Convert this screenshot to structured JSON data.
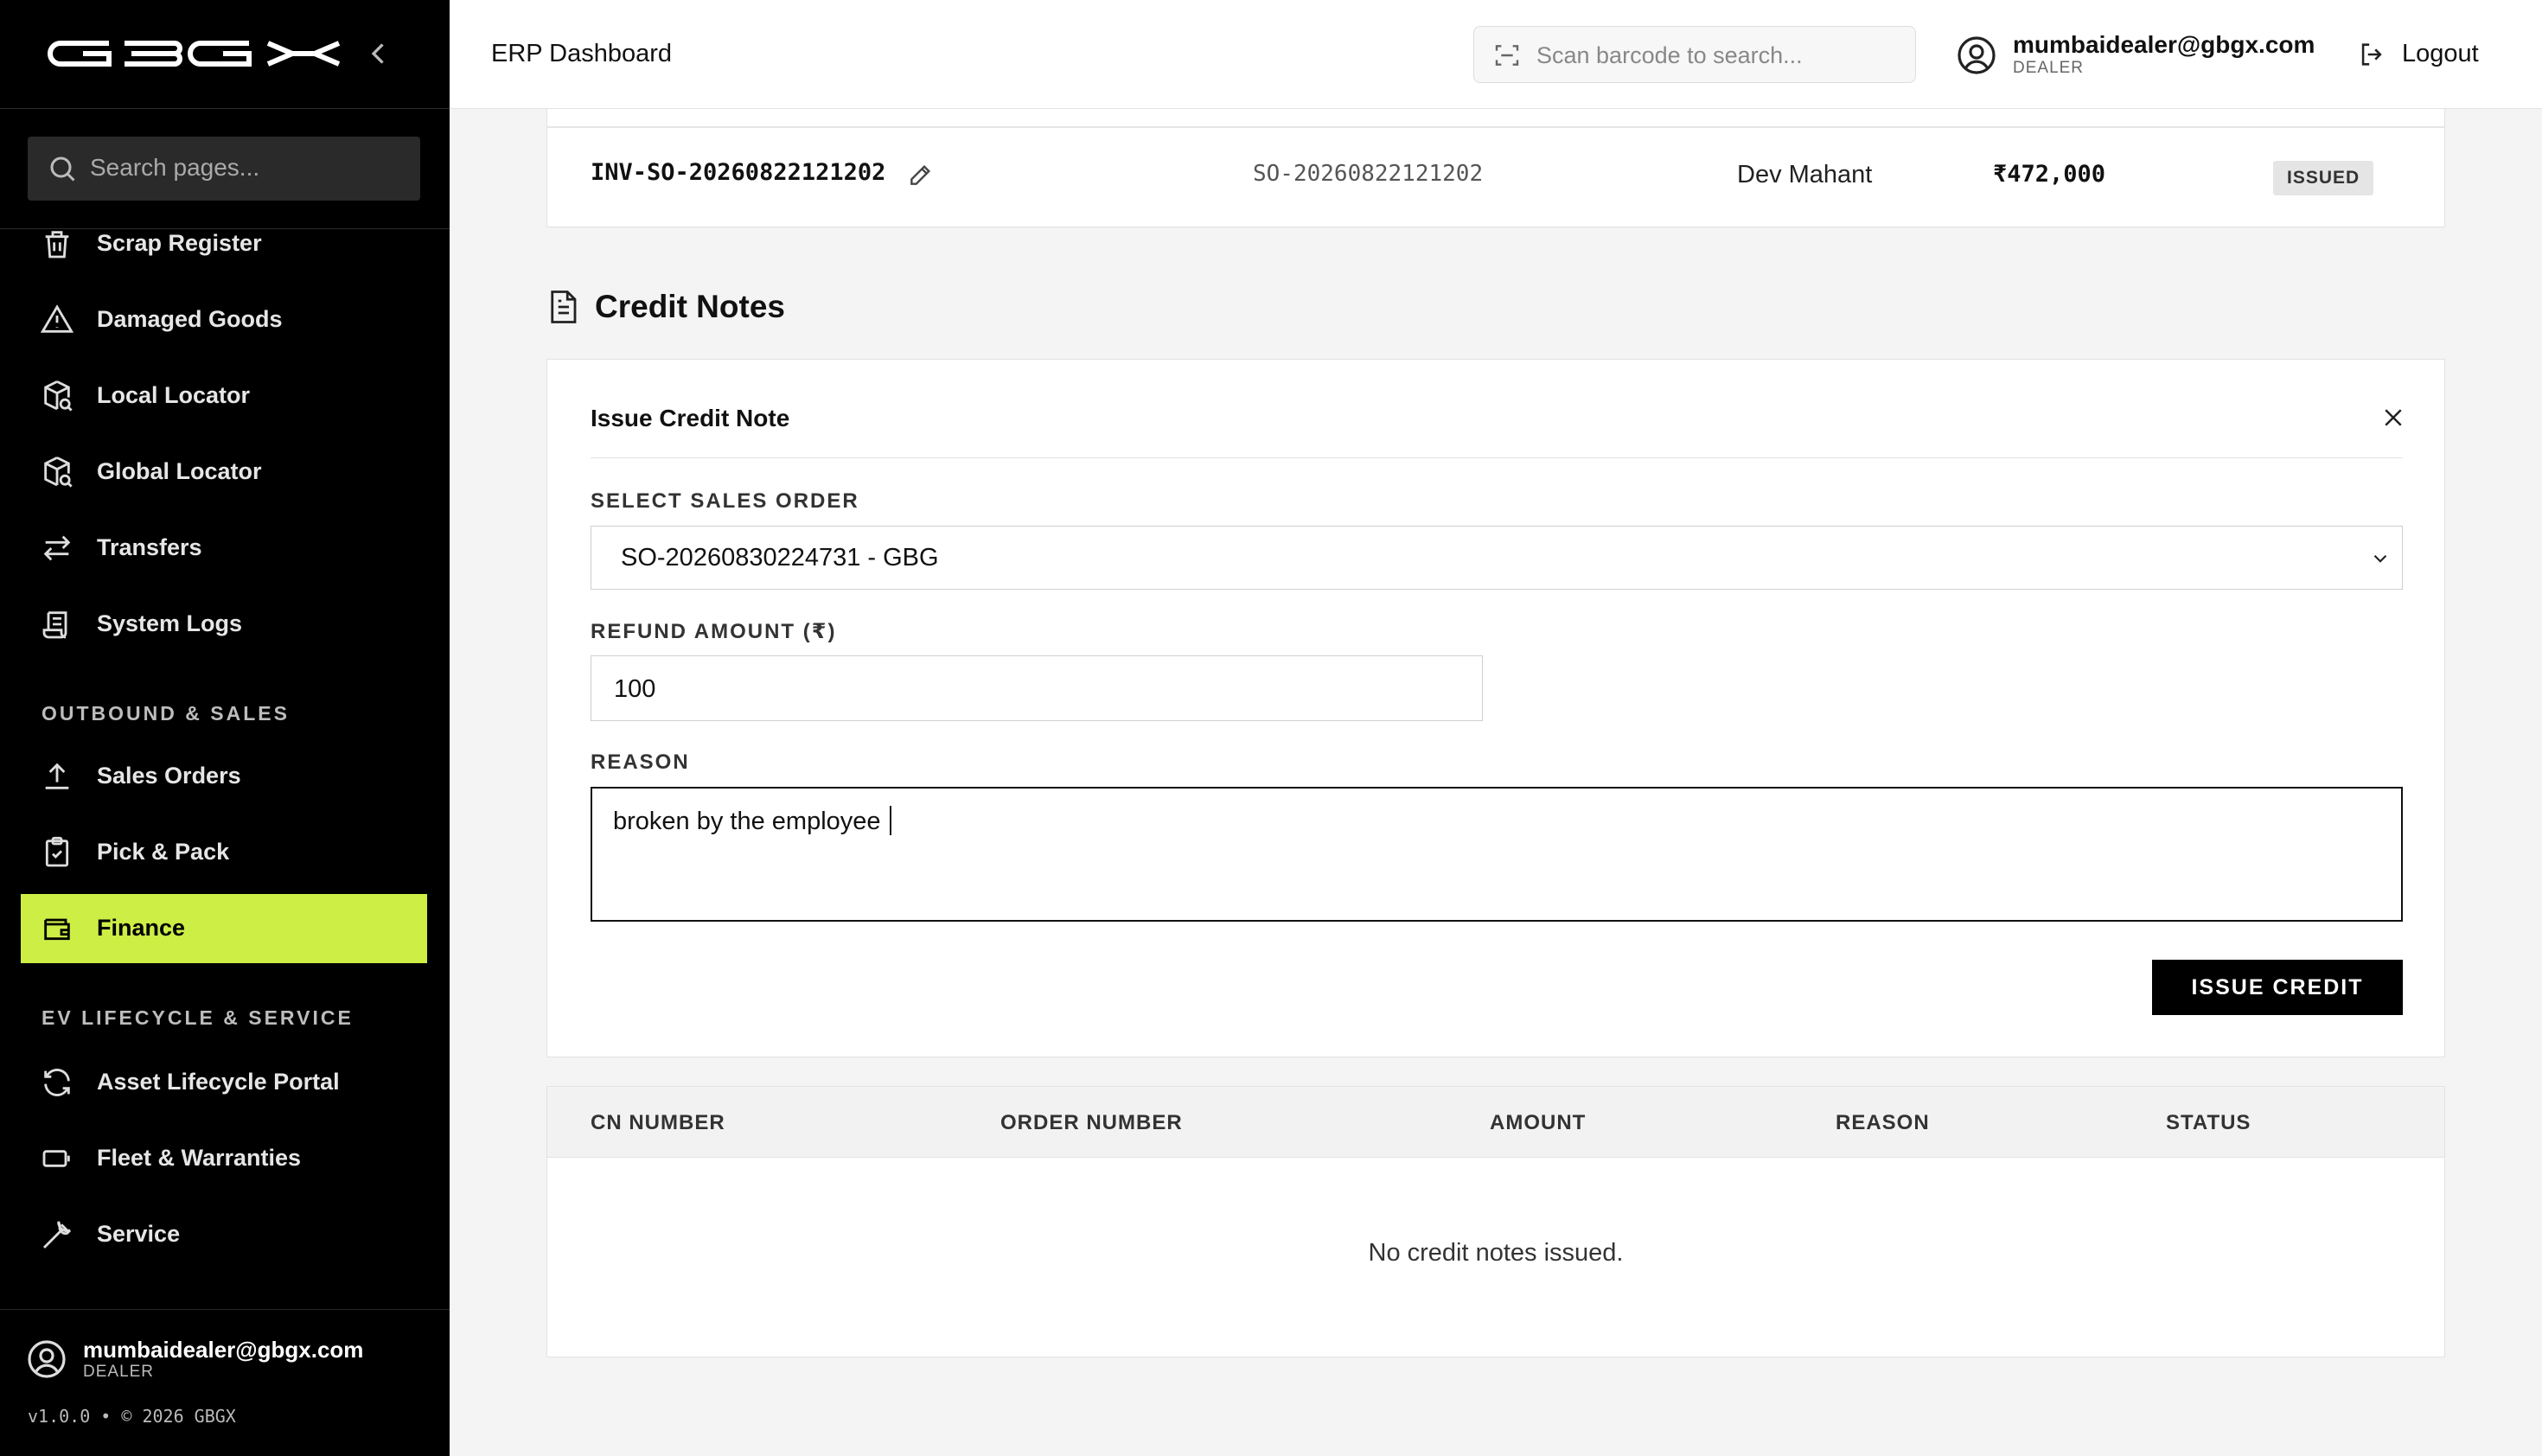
{
  "sidebar": {
    "search_placeholder": "Search pages...",
    "items": [
      {
        "label": "Scrap Register",
        "icon": "trash-icon"
      },
      {
        "label": "Damaged Goods",
        "icon": "warning-icon"
      },
      {
        "label": "Local Locator",
        "icon": "package-search-icon"
      },
      {
        "label": "Global Locator",
        "icon": "package-search-icon"
      },
      {
        "label": "Transfers",
        "icon": "arrows-swap-icon"
      },
      {
        "label": "System Logs",
        "icon": "scroll-icon"
      }
    ],
    "section_outbound": "OUTBOUND & SALES",
    "outbound_items": [
      {
        "label": "Sales Orders",
        "icon": "upload-icon"
      },
      {
        "label": "Pick & Pack",
        "icon": "clipboard-check-icon"
      },
      {
        "label": "Finance",
        "icon": "wallet-icon",
        "active": true
      }
    ],
    "section_ev": "EV LIFECYCLE & SERVICE",
    "ev_items": [
      {
        "label": "Asset Lifecycle Portal",
        "icon": "refresh-icon"
      },
      {
        "label": "Fleet & Warranties",
        "icon": "battery-icon"
      },
      {
        "label": "Service",
        "icon": "wrench-icon"
      }
    ],
    "user_email": "mumbaidealer@gbgx.com",
    "user_role": "DEALER",
    "version": "v1.0.0 • © 2026 GBGX"
  },
  "header": {
    "title": "ERP Dashboard",
    "barcode_placeholder": "Scan barcode to search...",
    "user_email": "mumbaidealer@gbgx.com",
    "user_role": "DEALER",
    "logout_label": "Logout"
  },
  "invoice_row": {
    "invoice_number": "INV-SO-20260822121202",
    "order_number": "SO-20260822121202",
    "customer": "Dev Mahant",
    "amount": "₹472,000",
    "status": "ISSUED"
  },
  "credit_notes": {
    "heading": "Credit Notes",
    "form": {
      "title": "Issue Credit Note",
      "select_label": "SELECT SALES ORDER",
      "select_value": "SO-20260830224731 - GBG",
      "amount_label": "REFUND AMOUNT (₹)",
      "amount_value": "100",
      "reason_label": "REASON",
      "reason_value": "broken by the employee",
      "submit_label": "ISSUE CREDIT"
    },
    "table": {
      "columns": [
        "CN NUMBER",
        "ORDER NUMBER",
        "AMOUNT",
        "REASON",
        "STATUS"
      ],
      "empty_message": "No credit notes issued."
    }
  },
  "colors": {
    "active_nav": "#cdee45",
    "sidebar_bg": "#000000",
    "button_bg": "#000000"
  }
}
